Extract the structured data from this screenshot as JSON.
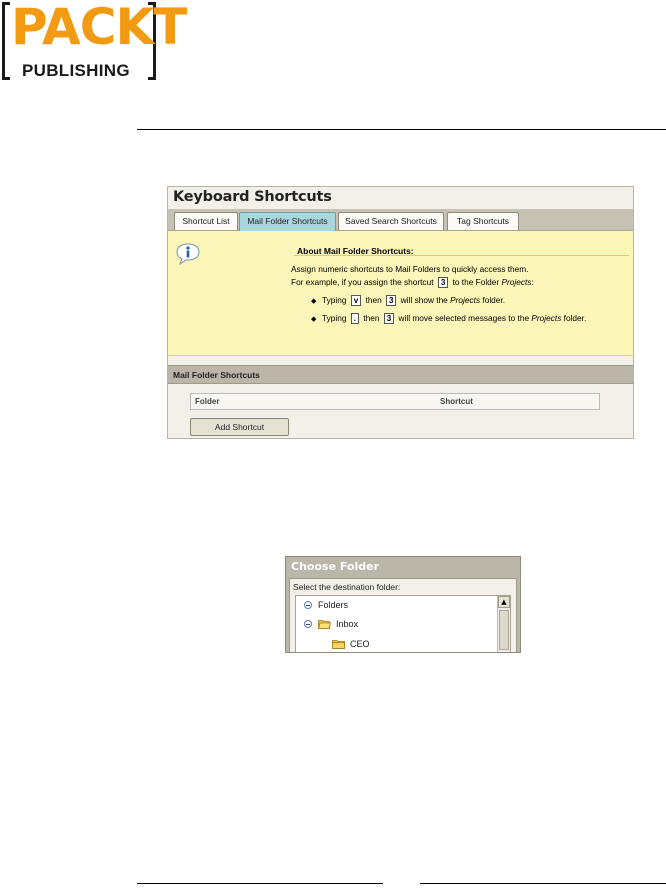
{
  "logo": {
    "word": "PACKT",
    "sub": "PUBLISHING",
    "brand_color": "#f29a12"
  },
  "keyboard_shortcuts": {
    "title": "Keyboard Shortcuts",
    "tabs": [
      {
        "label": "Shortcut List",
        "active": false
      },
      {
        "label": "Mail Folder Shortcuts",
        "active": true
      },
      {
        "label": "Saved Search Shortcuts",
        "active": false
      },
      {
        "label": "Tag Shortcuts",
        "active": false
      }
    ],
    "info": {
      "icon": "info-icon",
      "heading": "About Mail Folder Shortcuts:",
      "line1": "Assign numeric shortcuts to Mail Folders to quickly access them.",
      "line2_pre": "For example, if you assign the shortcut",
      "line2_key": "3",
      "line2_mid": "to the Folder",
      "line2_folder": "Projects",
      "line2_post": ":",
      "bullet1": {
        "typing": "Typing",
        "key1": "v",
        "then": "then",
        "key2": "3",
        "rest": "will show the",
        "folder": "Projects",
        "tail": "folder."
      },
      "bullet2": {
        "typing": "Typing",
        "key1": ".",
        "then": "then",
        "key2": "3",
        "rest": "will move selected messages to the",
        "folder": "Projects",
        "tail": "folder."
      }
    },
    "section_header": "Mail Folder Shortcuts",
    "columns": {
      "folder": "Folder",
      "shortcut": "Shortcut"
    },
    "add_button": "Add Shortcut"
  },
  "choose_folder": {
    "title": "Choose Folder",
    "subtitle": "Select the destination folder:",
    "tree": [
      {
        "label": "Folders",
        "icon": "collapse-icon"
      },
      {
        "label": "Inbox",
        "icon": "folder-icon"
      },
      {
        "label": "CEO",
        "icon": "folder-icon"
      }
    ]
  }
}
